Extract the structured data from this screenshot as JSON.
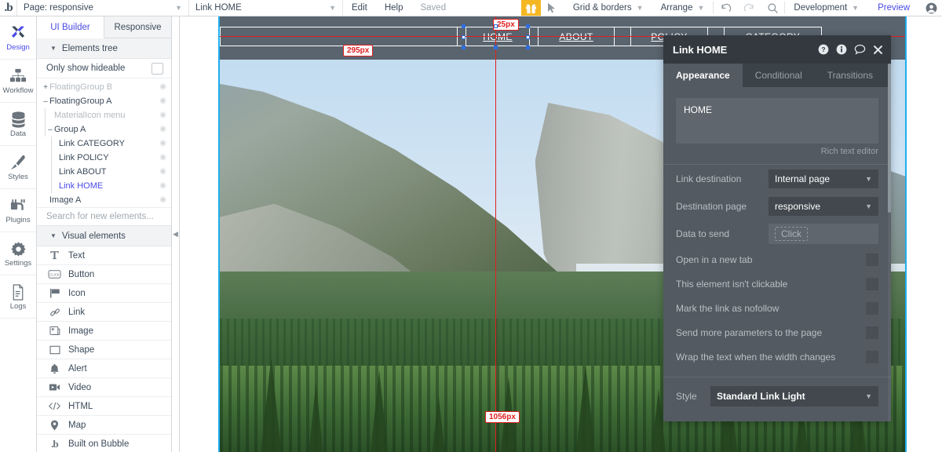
{
  "topbar": {
    "logo": "bubble-logo",
    "page_selector": {
      "label": "Page: responsive",
      "icon": "chevron-down-icon"
    },
    "element_selector": {
      "label": "Link HOME",
      "icon": "chevron-down-icon"
    },
    "menu": [
      {
        "label": "Edit"
      },
      {
        "label": "Help"
      }
    ],
    "saved_status": "Saved",
    "gift_icon": "gift-icon",
    "pointer_icon": "cursor-arrow-icon",
    "grid_borders": {
      "label": "Grid & borders",
      "icon": "chevron-down-icon"
    },
    "arrange": {
      "label": "Arrange",
      "icon": "chevron-down-icon"
    },
    "undo_icon": "undo-icon",
    "redo_icon": "redo-icon",
    "search_icon": "search-icon",
    "development": {
      "label": "Development",
      "icon": "chevron-down-icon"
    },
    "preview": "Preview",
    "avatar_icon": "user-avatar-icon"
  },
  "rail": [
    {
      "label": "Design",
      "icon": "design-tools-icon",
      "active": true
    },
    {
      "label": "Workflow",
      "icon": "workflow-icon",
      "active": false
    },
    {
      "label": "Data",
      "icon": "database-icon",
      "active": false
    },
    {
      "label": "Styles",
      "icon": "paintbrush-icon",
      "active": false
    },
    {
      "label": "Plugins",
      "icon": "plug-icon",
      "active": false
    },
    {
      "label": "Settings",
      "icon": "gear-icon",
      "active": false
    },
    {
      "label": "Logs",
      "icon": "document-icon",
      "active": false
    }
  ],
  "left_panel": {
    "tabs": [
      {
        "label": "UI Builder",
        "active": true
      },
      {
        "label": "Responsive",
        "active": false
      }
    ],
    "elements_tree_header": {
      "label": "Elements tree",
      "icon": "triangle-down-icon"
    },
    "only_show_hideable": {
      "label": "Only show hideable",
      "checked": false
    },
    "tree": [
      {
        "label": "FloatingGroup B",
        "toggle": "+",
        "indent": 0,
        "state": "dim",
        "eye": "eye-slash-icon"
      },
      {
        "label": "FloatingGroup A",
        "toggle": "–",
        "indent": 0,
        "state": "normal",
        "eye": "eye-icon"
      },
      {
        "label": "MaterialIcon menu",
        "toggle": "",
        "indent": 1,
        "state": "dim",
        "eye": "eye-slash-icon"
      },
      {
        "label": "Group A",
        "toggle": "–",
        "indent": 1,
        "state": "normal",
        "eye": "eye-icon"
      },
      {
        "label": "Link CATEGORY",
        "toggle": "",
        "indent": 2,
        "state": "normal",
        "eye": "eye-icon"
      },
      {
        "label": "Link POLICY",
        "toggle": "",
        "indent": 2,
        "state": "normal",
        "eye": "eye-icon"
      },
      {
        "label": "Link ABOUT",
        "toggle": "",
        "indent": 2,
        "state": "normal",
        "eye": "eye-icon"
      },
      {
        "label": "Link HOME",
        "toggle": "",
        "indent": 2,
        "state": "selected",
        "eye": "eye-icon"
      },
      {
        "label": "Image A",
        "toggle": "",
        "indent": 0,
        "state": "normal",
        "eye": "eye-icon"
      }
    ],
    "search_placeholder": "Search for new elements...",
    "visual_elements_header": {
      "label": "Visual elements",
      "icon": "triangle-down-icon"
    },
    "visual_elements": [
      {
        "label": "Text",
        "icon": "text-t-icon"
      },
      {
        "label": "Button",
        "icon": "button-click-icon"
      },
      {
        "label": "Icon",
        "icon": "flag-icon"
      },
      {
        "label": "Link",
        "icon": "link-chain-icon"
      },
      {
        "label": "Image",
        "icon": "image-icon"
      },
      {
        "label": "Shape",
        "icon": "square-shape-icon"
      },
      {
        "label": "Alert",
        "icon": "bell-icon"
      },
      {
        "label": "Video",
        "icon": "video-camera-icon"
      },
      {
        "label": "HTML",
        "icon": "code-brackets-icon"
      },
      {
        "label": "Map",
        "icon": "map-pin-icon"
      },
      {
        "label": "Built on Bubble",
        "icon": "bubble-b-icon"
      }
    ],
    "collapse_handle_icon": "chevron-left-icon"
  },
  "canvas": {
    "nav_links": [
      "HOME",
      "ABOUT",
      "POLICY",
      "CATEGORY"
    ],
    "measurements": [
      {
        "value": "25px",
        "name": "top-offset-measurement"
      },
      {
        "value": "295px",
        "name": "left-offset-measurement"
      },
      {
        "value": "1056px",
        "name": "width-measurement"
      }
    ]
  },
  "properties": {
    "title": "Link HOME",
    "header_icons": [
      "help-question-icon",
      "info-icon",
      "comment-bubble-icon",
      "close-icon"
    ],
    "tabs": [
      {
        "label": "Appearance",
        "active": true
      },
      {
        "label": "Conditional",
        "active": false
      },
      {
        "label": "Transitions",
        "active": false
      }
    ],
    "rich_text_value": "HOME",
    "rich_text_caption": "Rich text editor",
    "fields": [
      {
        "label": "Link destination",
        "value": "Internal page",
        "type": "select"
      },
      {
        "label": "Destination page",
        "value": "responsive",
        "type": "select"
      },
      {
        "label": "Data to send",
        "value": "Click",
        "type": "chip"
      }
    ],
    "checkboxes": [
      {
        "label": "Open in a new tab",
        "checked": false
      },
      {
        "label": "This element isn't clickable",
        "checked": false
      },
      {
        "label": "Mark the link as nofollow",
        "checked": false
      },
      {
        "label": "Send more parameters to the page",
        "checked": false
      },
      {
        "label": "Wrap the text when the width changes",
        "checked": false
      }
    ],
    "style": {
      "label": "Style",
      "value": "Standard Link Light"
    }
  },
  "colors": {
    "accent_blue": "#4a4ae8",
    "guide_red": "#e02020",
    "panel_dark": "#535a61",
    "panel_header": "#33393f",
    "gift_yellow": "#f5b721",
    "canvas_border_blue": "#1eaeee",
    "navbar_gray": "#5a646e"
  }
}
